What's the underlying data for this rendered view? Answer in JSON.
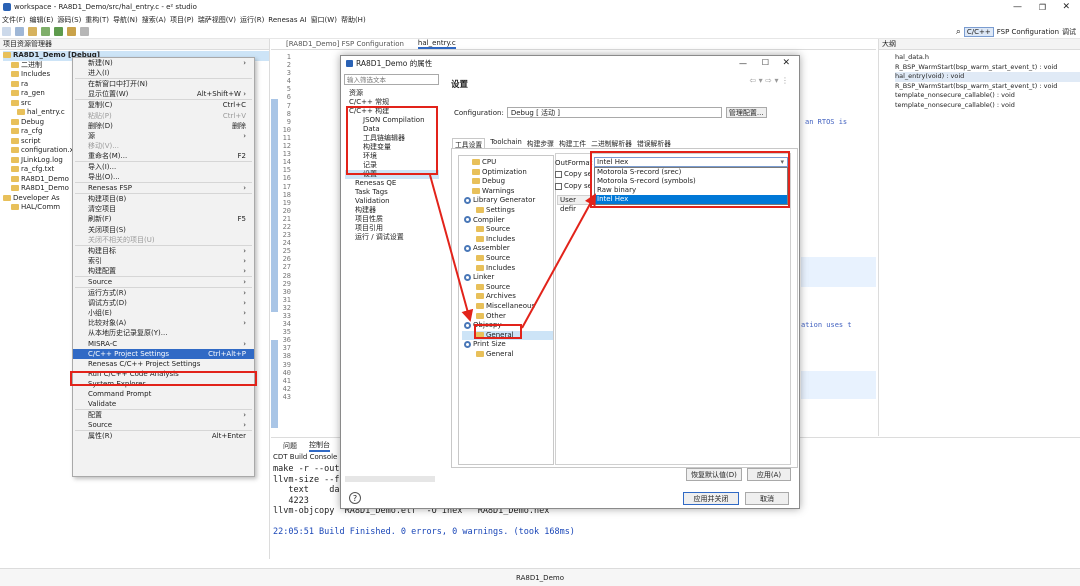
{
  "window": {
    "title": "workspace - RA8D1_Demo/src/hal_entry.c - e² studio"
  },
  "menu": [
    "文件(F)",
    "编辑(E)",
    "源码(S)",
    "重构(T)",
    "导航(N)",
    "搜索(A)",
    "项目(P)",
    "瑞萨视图(V)",
    "运行(R)",
    "Renesas AI",
    "窗口(W)",
    "帮助(H)"
  ],
  "perspectives": {
    "cpp": "C/C++",
    "fsp": "FSP Configuration",
    "debug": "调试"
  },
  "explorer": {
    "tab": "项目资源管理器",
    "items": [
      "RA8D1_Demo [Debug]",
      "二进制",
      "Includes",
      "ra",
      "ra_gen",
      "src",
      "hal_entry.c",
      "Debug",
      "ra_cfg",
      "script",
      "configuration.x",
      "JLinkLog.log",
      "ra_cfg.txt",
      "RA8D1_Demo",
      "RA8D1_Demo",
      "Developer As",
      "HAL/Comm"
    ]
  },
  "ctx": {
    "items": [
      {
        "l": "新建(N)",
        "k": "›"
      },
      {
        "l": "进入(I)"
      },
      {
        "sep": 1
      },
      {
        "l": "在新窗口中打开(N)"
      },
      {
        "l": "显示位置(W)",
        "k": "Alt+Shift+W ›"
      },
      {
        "sep": 1
      },
      {
        "l": "复制(C)",
        "k": "Ctrl+C"
      },
      {
        "l": "粘贴(P)",
        "k": "Ctrl+V",
        "d": 1
      },
      {
        "l": "删除(D)",
        "k": "删除"
      },
      {
        "l": "源",
        "k": "›"
      },
      {
        "l": "移动(V)...",
        "d": 1
      },
      {
        "l": "重命名(M)...",
        "k": "F2"
      },
      {
        "sep": 1
      },
      {
        "l": "导入(I)..."
      },
      {
        "l": "导出(O)..."
      },
      {
        "sep": 1
      },
      {
        "l": "Renesas FSP",
        "k": "›"
      },
      {
        "sep": 1
      },
      {
        "l": "构建项目(B)"
      },
      {
        "l": "清空项目"
      },
      {
        "l": "刷新(F)",
        "k": "F5"
      },
      {
        "l": "关闭项目(S)"
      },
      {
        "l": "关闭不相关的项目(U)",
        "d": 1
      },
      {
        "sep": 1
      },
      {
        "l": "构建目标",
        "k": "›"
      },
      {
        "l": "索引",
        "k": "›"
      },
      {
        "l": "构建配置",
        "k": "›"
      },
      {
        "sep": 1
      },
      {
        "l": "Source",
        "k": "›"
      },
      {
        "sep": 1
      },
      {
        "l": "运行方式(R)",
        "k": "›"
      },
      {
        "l": "调试方式(D)",
        "k": "›"
      },
      {
        "l": "小组(E)",
        "k": "›"
      },
      {
        "l": "比较对象(A)",
        "k": "›"
      },
      {
        "l": "从本地历史记录复原(Y)..."
      },
      {
        "l": "MISRA-C",
        "k": "›"
      },
      {
        "l": "C/C++ Project Settings",
        "k": "Ctrl+Alt+P",
        "hl": 1
      },
      {
        "l": "Renesas C/C++ Project Settings"
      },
      {
        "l": "Run C/C++ Code Analysis"
      },
      {
        "l": "System Explorer"
      },
      {
        "l": "Command Prompt"
      },
      {
        "l": "Validate"
      },
      {
        "sep": 1
      },
      {
        "l": "配置",
        "k": "›"
      },
      {
        "l": "Source",
        "k": "›"
      },
      {
        "sep": 1
      },
      {
        "l": "属性(R)",
        "k": "Alt+Enter"
      }
    ]
  },
  "editor": {
    "tabs": [
      "[RA8D1_Demo] FSP Configuration",
      "hal_entry.c"
    ],
    "lines": [
      "1",
      "2",
      "3",
      "4",
      "5",
      "6",
      "7",
      "8",
      "9",
      "10",
      "11",
      "12",
      "13",
      "14",
      "15",
      "16",
      "17",
      "18",
      "19",
      "20",
      "21",
      "22",
      "23",
      "24",
      "25",
      "26",
      "27",
      "28",
      "29",
      "30",
      "31",
      "32",
      "33",
      "34",
      "35",
      "36",
      "37",
      "38",
      "39",
      "40",
      "41",
      "42",
      "43"
    ],
    "frag1": "an RTOS is",
    "frag2": "ation uses t"
  },
  "outline": {
    "tab": "大纲",
    "items": [
      "hal_data.h",
      "R_BSP_WarmStart(bsp_warm_start_event_t) : void",
      "hal_entry(void) : void",
      "R_BSP_WarmStart(bsp_warm_start_event_t) : void",
      "template_nonsecure_callable() : void",
      "template_nonsecure_callable() : void"
    ]
  },
  "console": {
    "tabs": [
      "问题",
      "控制台"
    ],
    "title": "CDT Build Console [R",
    "lines": [
      "make -r --out",
      "llvm-size --f",
      "   text    da",
      "   4223",
      "llvm-objcopy \"RA8D1_Demo.elf\" -O ihex  \"RA8D1_Demo.hex\"",
      "",
      "22:05:51 Build Finished. 0 errors, 0 warnings. (took 168ms)"
    ]
  },
  "dialog": {
    "title": "RA8D1_Demo 的属性",
    "filter_placeholder": "输入筛选文本",
    "section": "设置",
    "nav": [
      "资源",
      "C/C++ 常规",
      "C/C++ 构建",
      "JSON Compilation Data",
      "工具链编辑器",
      "构建变量",
      "环境",
      "记录",
      "设置",
      "Renesas QE",
      "Task Tags",
      "Validation",
      "构建器",
      "项目性质",
      "项目引用",
      "运行 / 调试设置"
    ],
    "config_label": "Configuration:",
    "config_value": "Debug [ 活动 ]",
    "manage": "管理配置...",
    "subtabs": [
      "工具设置",
      "Toolchain",
      "构建步骤",
      "构建工件",
      "二进制解析器",
      "错误解析器"
    ],
    "tools": [
      "CPU",
      "Optimization",
      "Debug",
      "Warnings",
      "Library Generator",
      "Settings",
      "Compiler",
      "Source",
      "Includes",
      "Assembler",
      "Source",
      "Includes",
      "Linker",
      "Source",
      "Archives",
      "Miscellaneous",
      "Other",
      "Objcopy",
      "General",
      "Print Size",
      "General"
    ],
    "out_label": "OutFormat",
    "out_value": "Intel Hex",
    "options": [
      "Motorola S-record (srec)",
      "Motorola S-record (symbols)",
      "Raw binary",
      "Intel Hex"
    ],
    "copy1": "Copy se",
    "copy2": "Copy se",
    "userdef": "User defir",
    "restore": "恢复默认值(D)",
    "apply": "应用(A)",
    "apply_close": "应用并关闭",
    "cancel": "取消",
    "help": "?"
  },
  "status": {
    "project": "RA8D1_Demo"
  },
  "colors": {
    "red": "#e2231a",
    "selection": "#0078d7",
    "accent": "#316ac5"
  }
}
